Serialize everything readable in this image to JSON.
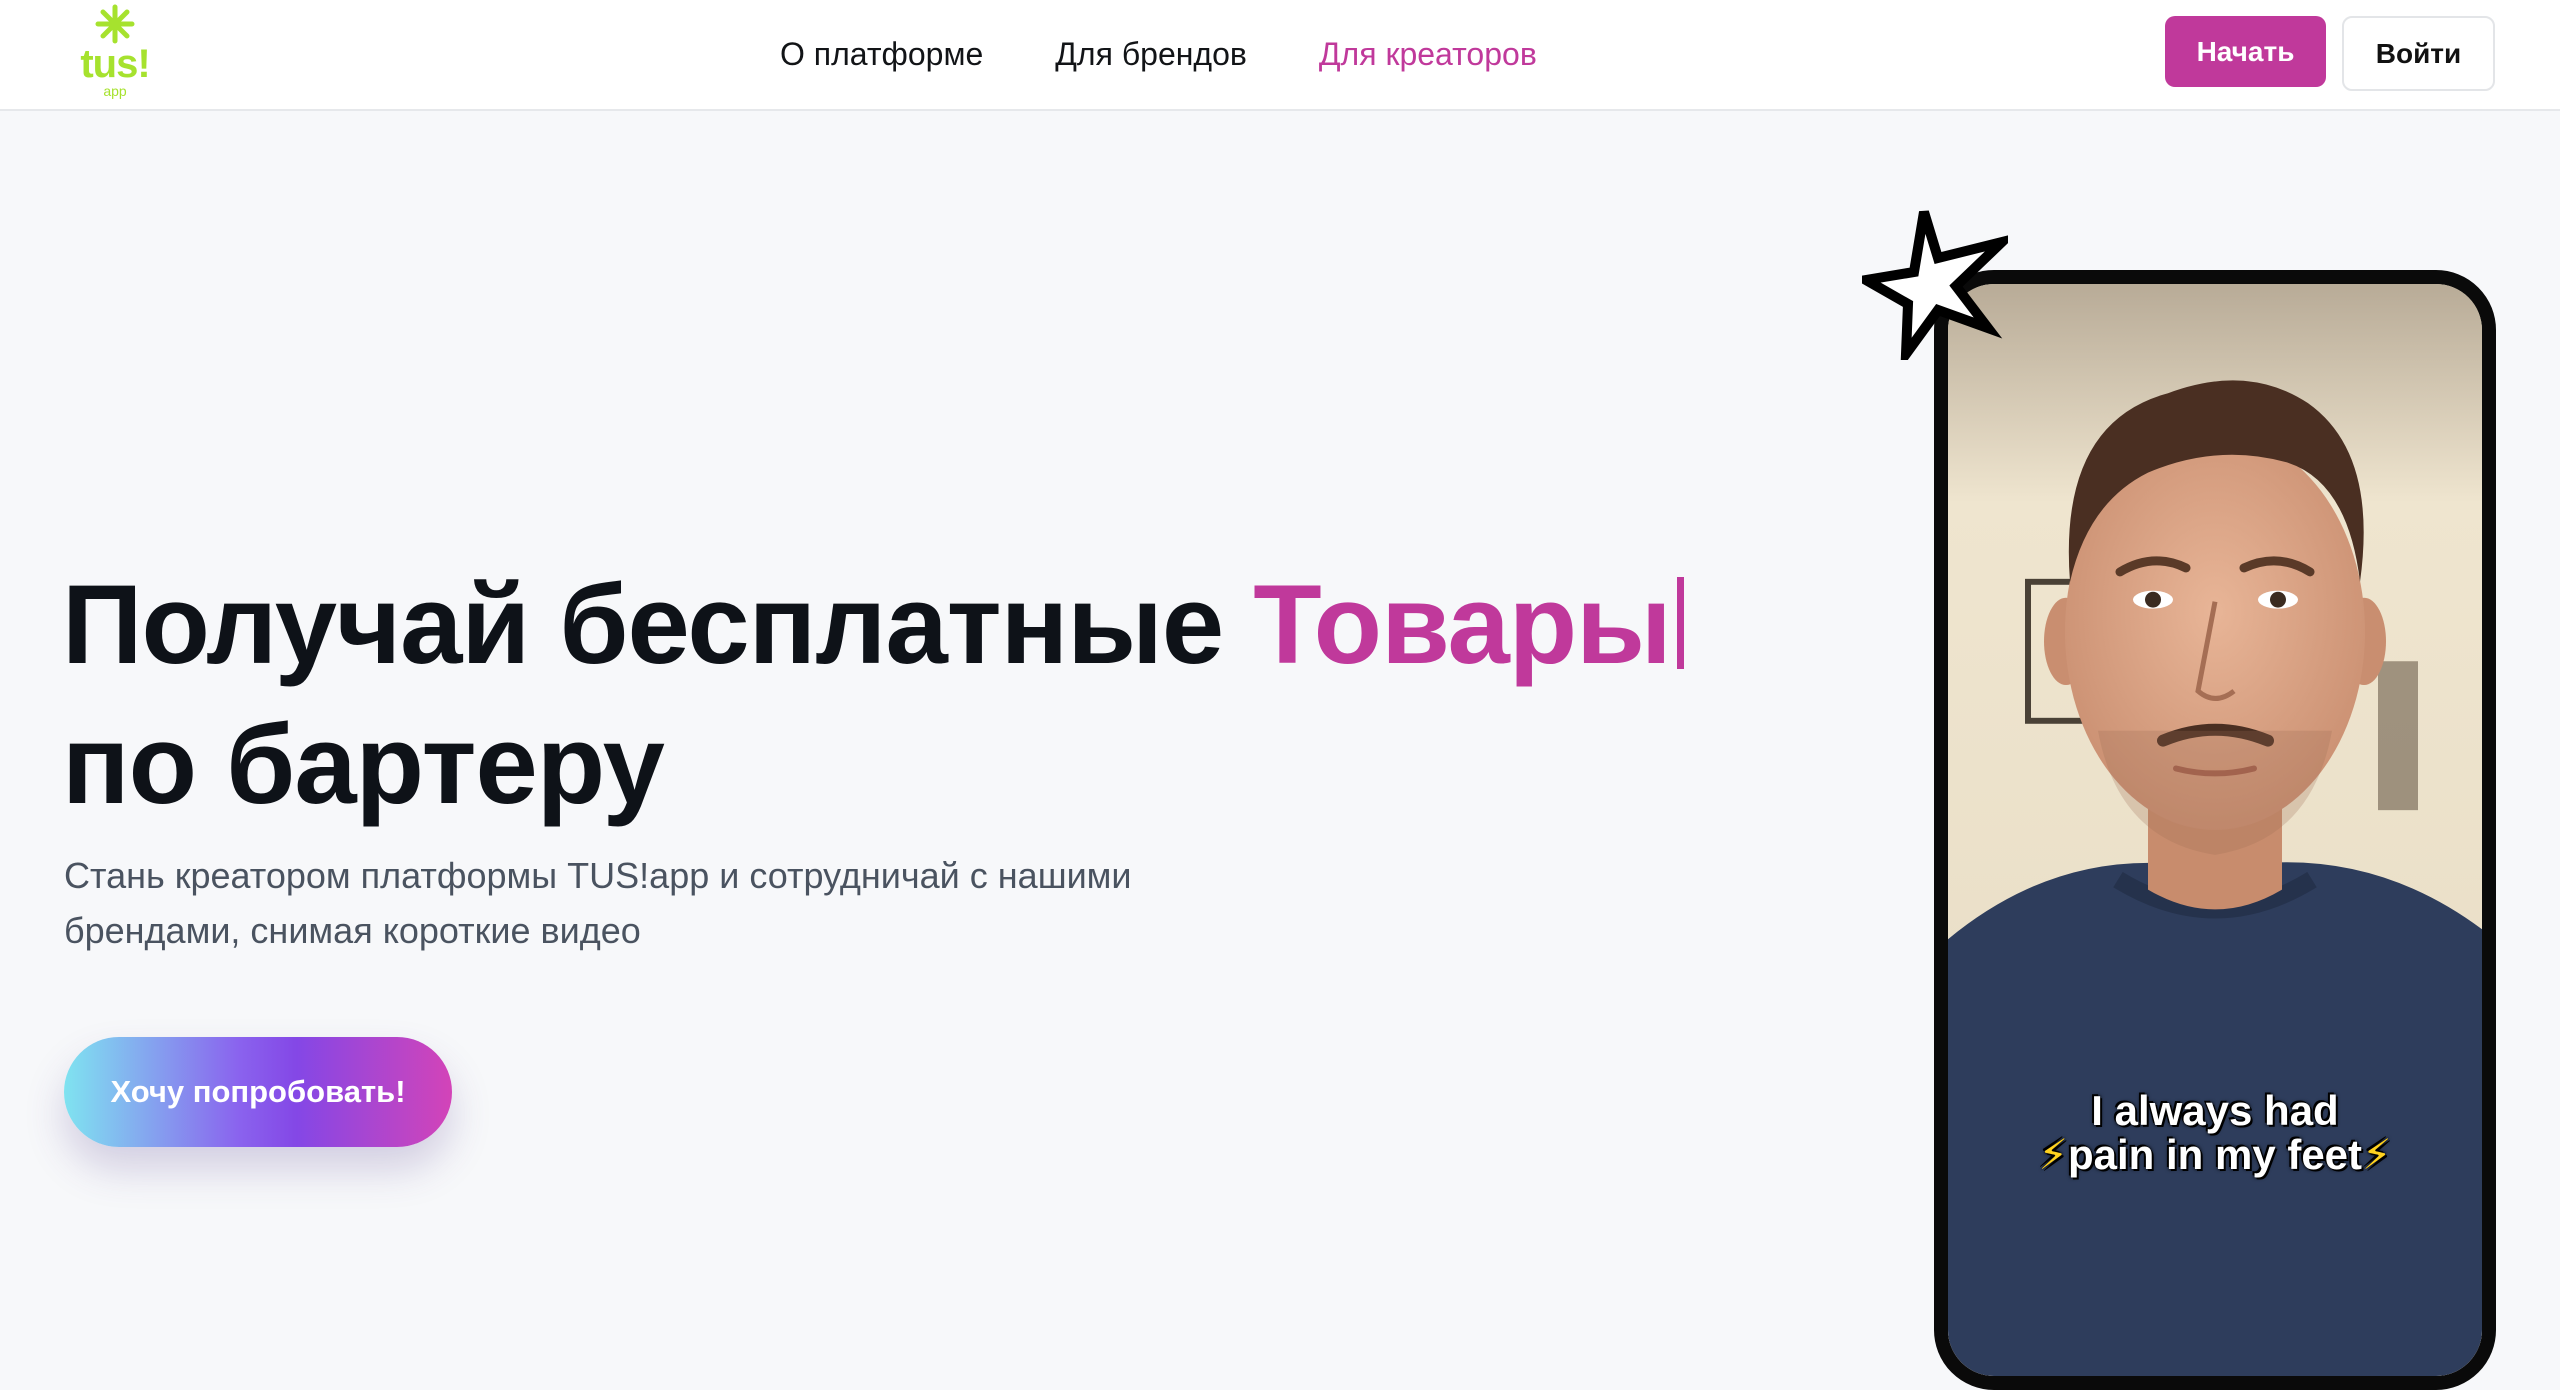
{
  "header": {
    "logo": {
      "word": "tus!",
      "sub": "app",
      "icon": "asterisk-flower-icon"
    },
    "nav": [
      {
        "label": "О платформе",
        "active": false
      },
      {
        "label": "Для брендов",
        "active": false
      },
      {
        "label": "Для креаторов",
        "active": true
      }
    ],
    "start_label": "Начать",
    "login_label": "Войти"
  },
  "hero": {
    "title_part1": "Получай бесплатные",
    "title_accent": "Товары",
    "title_line2": "по бартеру",
    "subtitle": "Стань креатором платформы TUS!app и сотрудничай с нашими брендами, снимая короткие видео",
    "cta_label": "Хочу попробовать!"
  },
  "video": {
    "caption_line1": "I always had",
    "caption_line2": "pain in my feet",
    "caption_emoji": "⚡",
    "decoration_icon": "sparkle-star-icon"
  },
  "colors": {
    "accent": "#c0399b",
    "logo_green": "#a6e22e",
    "text_dark": "#0e1218",
    "text_muted": "#4a5360",
    "background": "#f7f8fa"
  }
}
